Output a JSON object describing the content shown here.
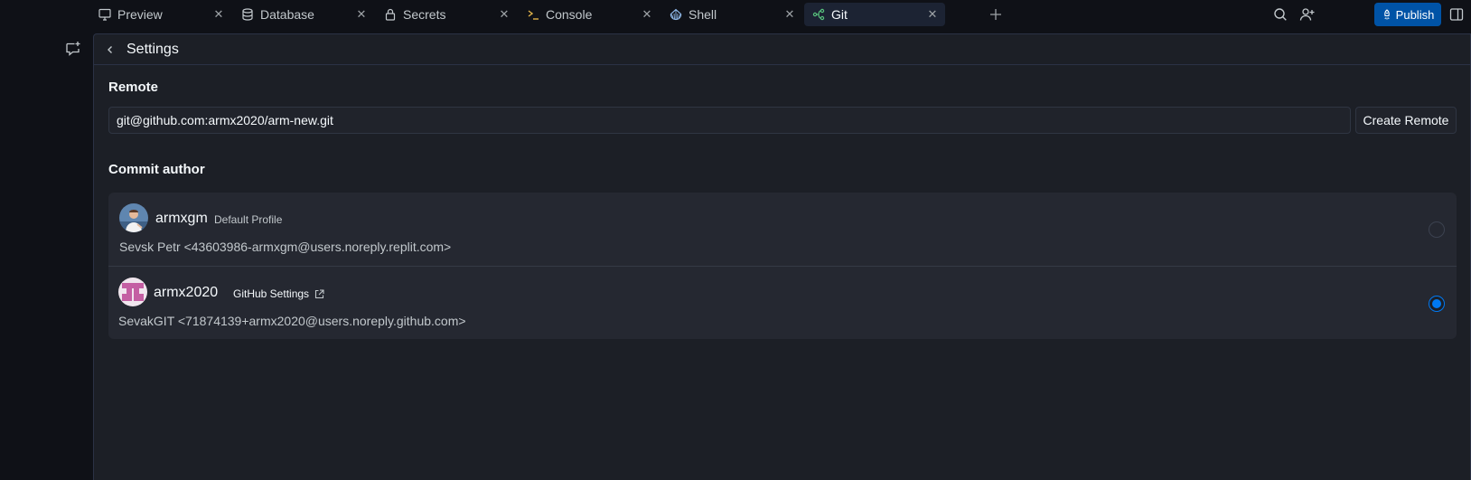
{
  "tabs": [
    {
      "label": "Preview",
      "icon": "monitor-icon",
      "active": false
    },
    {
      "label": "Database",
      "icon": "database-icon",
      "active": false
    },
    {
      "label": "Secrets",
      "icon": "lock-icon",
      "active": false
    },
    {
      "label": "Console",
      "icon": "terminal-prompt-icon",
      "active": false
    },
    {
      "label": "Shell",
      "icon": "shell-icon",
      "active": false
    },
    {
      "label": "Git",
      "icon": "git-branch-icon",
      "active": true
    }
  ],
  "topbar": {
    "publish_label": "Publish"
  },
  "panel": {
    "title": "Settings"
  },
  "remote": {
    "heading": "Remote",
    "url": "git@github.com:armx2020/arm-new.git",
    "create_label": "Create Remote"
  },
  "commit_author": {
    "heading": "Commit author",
    "authors": [
      {
        "username": "armxgm",
        "tag": "Default Profile",
        "identity": "Sevsk Petr <43603986-armxgm@users.noreply.replit.com>",
        "selected": false
      },
      {
        "username": "armx2020",
        "tag": "GitHub Settings",
        "identity": "SevakGIT <71874139+armx2020@users.noreply.github.com>",
        "selected": true
      }
    ]
  },
  "colors": {
    "accent": "#0079f2",
    "publish": "#0053a6",
    "git_icon": "#58c27d",
    "console_icon": "#e0b34a",
    "panel_bg": "#1c1f26"
  }
}
